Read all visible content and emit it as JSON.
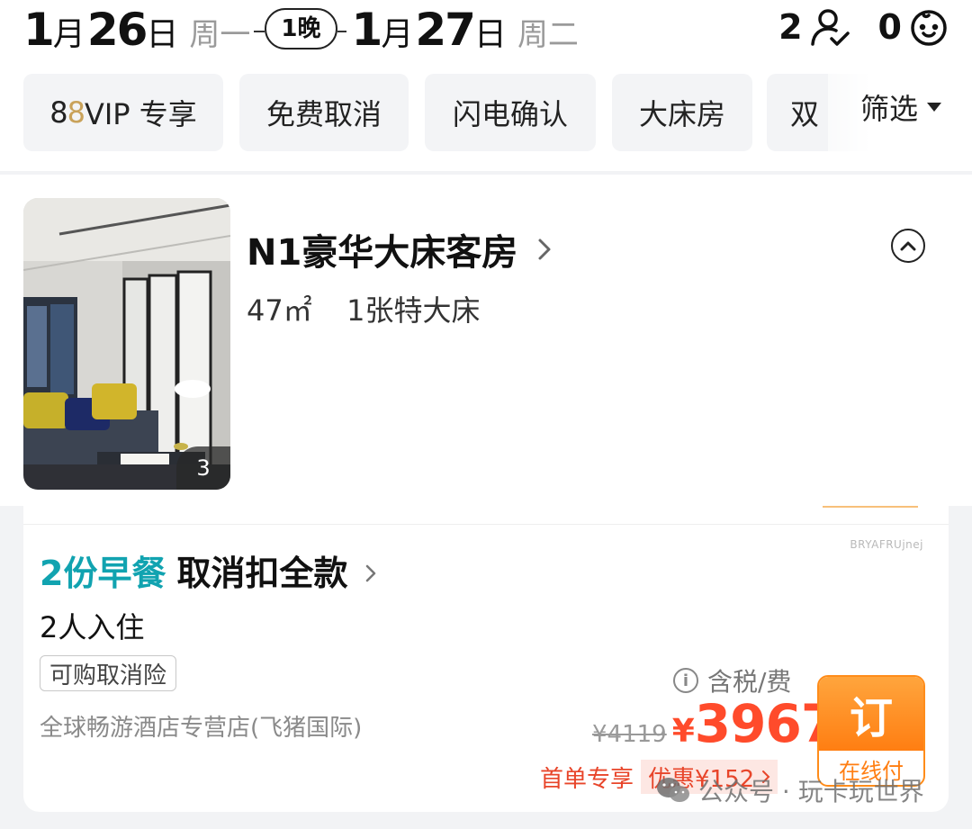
{
  "dates": {
    "checkin_day": "1",
    "checkin_unit_month": "月",
    "checkin_date": "26",
    "checkin_unit_day": "日",
    "checkin_weekday": "周一",
    "nights": "1晚",
    "checkout_day": "1",
    "checkout_unit_month": "月",
    "checkout_date": "27",
    "checkout_unit_day": "日",
    "checkout_weekday": "周二"
  },
  "guests": {
    "adults": "2",
    "children": "0",
    "adult_icon": "person-icon",
    "child_icon": "baby-icon"
  },
  "filters": {
    "chips": [
      "VIP 专享",
      "免费取消",
      "闪电确认",
      "大床房",
      "双"
    ],
    "vip_prefix_a": "8",
    "vip_prefix_b": "8",
    "filter_label": "筛选"
  },
  "room": {
    "title": "N1豪华大床客房",
    "area": "47㎡",
    "bed": "1张特大床",
    "photo_count": "3"
  },
  "rate": {
    "code": "BRYAFRUjnej",
    "breakfast": "2份早餐",
    "cancel_policy": "取消扣全款",
    "occupancy": "2人入住",
    "insurance_tag": "可购取消险",
    "seller": "全球畅游酒店专营店(飞猪国际)",
    "tax_note": "含税/费",
    "original_price": "¥4119",
    "currency": "¥",
    "price": "3967",
    "first_order": "首单专享",
    "discount": "优惠¥152",
    "book_label": "订",
    "book_sub": "在线付"
  },
  "watermark": "公众号 · 玩卡玩世界",
  "colors": {
    "accent": "#ff7e12",
    "price": "#ff4b2b",
    "breakfast": "#11a3b0"
  }
}
